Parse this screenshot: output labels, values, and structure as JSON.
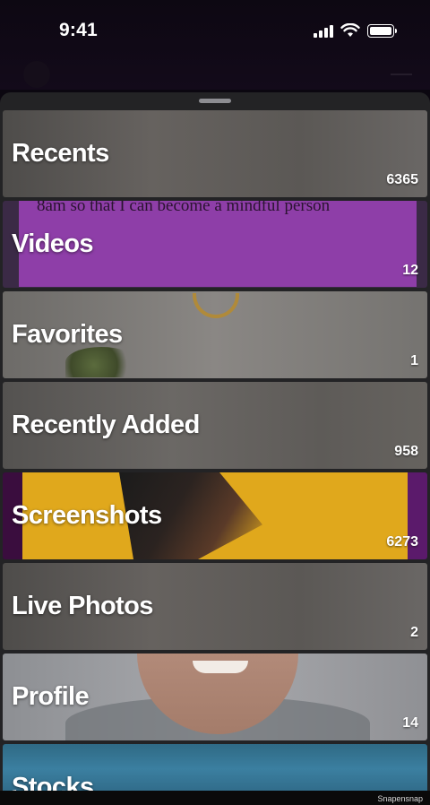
{
  "status_bar": {
    "time": "9:41"
  },
  "albums": [
    {
      "title": "Recents",
      "count": "6365"
    },
    {
      "title": "Videos",
      "count": "12",
      "preview_text": "8am so that I can become a mindful person"
    },
    {
      "title": "Favorites",
      "count": "1"
    },
    {
      "title": "Recently Added",
      "count": "958"
    },
    {
      "title": "Screenshots",
      "count": "6273"
    },
    {
      "title": "Live Photos",
      "count": "2"
    },
    {
      "title": "Profile",
      "count": "14"
    },
    {
      "title": "Stocks",
      "count": ""
    }
  ],
  "watermark": "Snapensnap",
  "icons": [
    "signal-icon",
    "wifi-icon",
    "battery-icon",
    "sheet-grabber"
  ],
  "colors": {
    "sheet": "#232325",
    "background": "#0b0710",
    "text": "#ffffff"
  }
}
